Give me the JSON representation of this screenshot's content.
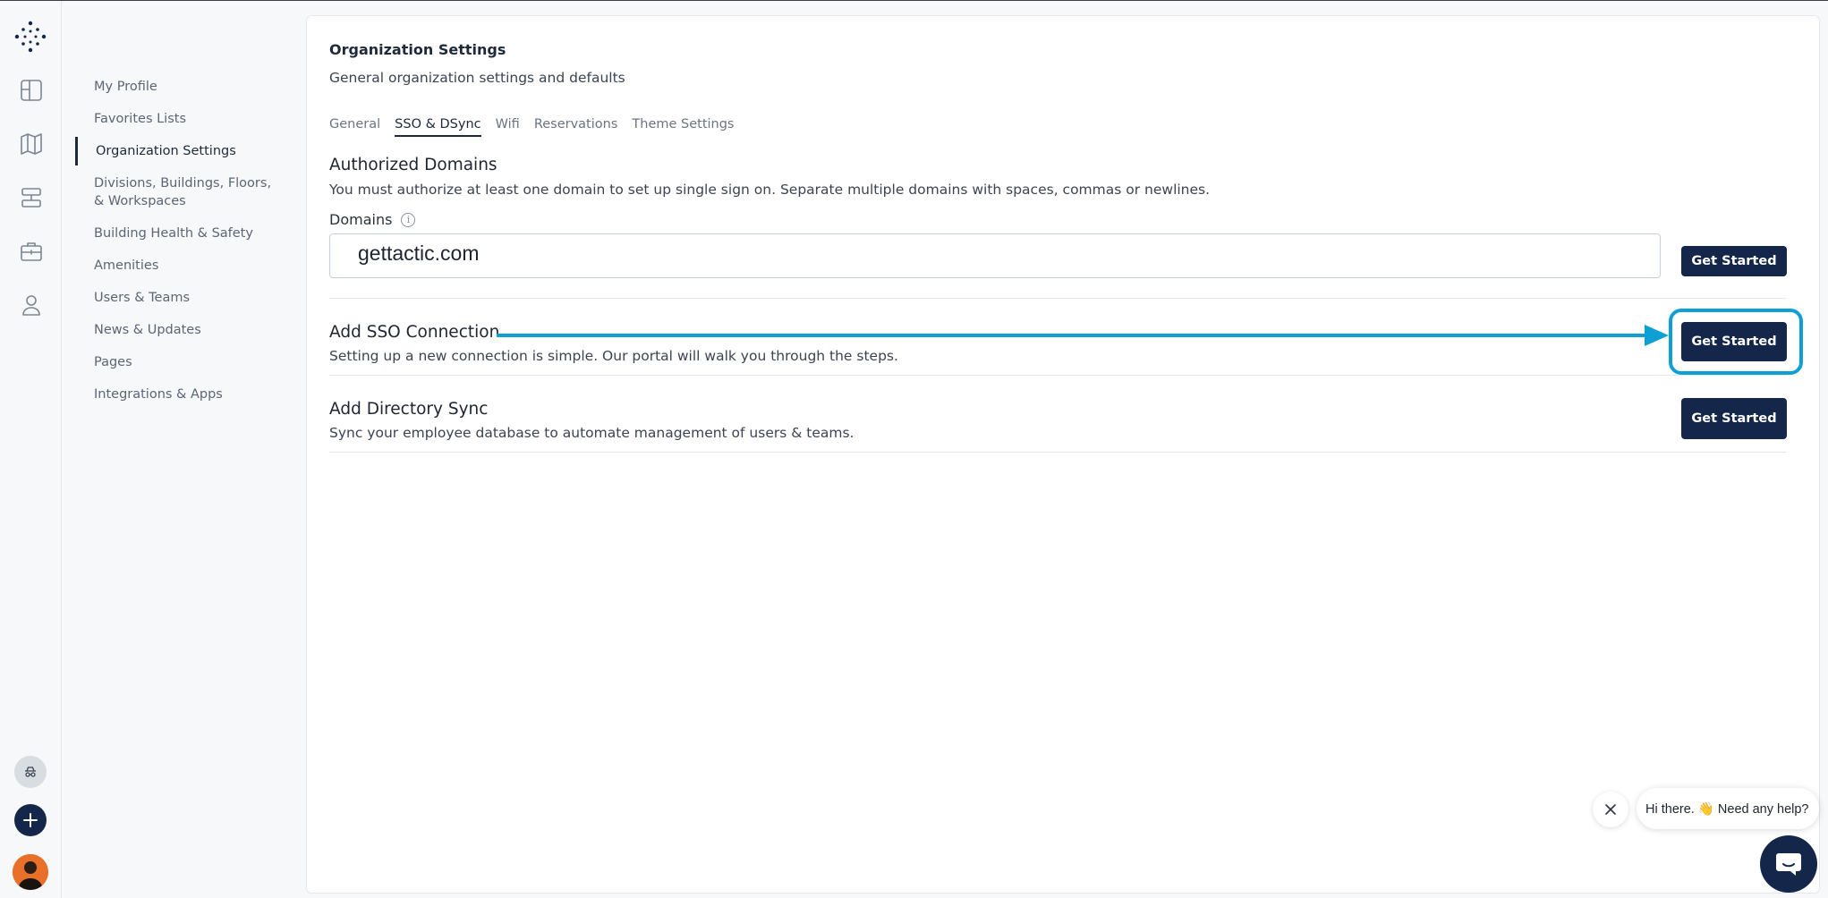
{
  "colors": {
    "primary": "#14274a",
    "highlight": "#0ea0d2",
    "text": "#1e2530",
    "muted": "#5a6676"
  },
  "rail": {
    "icons": [
      "logo-icon",
      "floorplan-icon",
      "map-icon",
      "desks-icon",
      "briefcase-icon",
      "user-icon",
      "ghost-icon",
      "plus-icon",
      "avatar"
    ]
  },
  "subnav": {
    "items": [
      {
        "label": "My Profile"
      },
      {
        "label": "Favorites Lists"
      },
      {
        "label": "Organization Settings",
        "active": true
      },
      {
        "label": "Divisions, Buildings, Floors, & Workspaces"
      },
      {
        "label": "Building Health & Safety"
      },
      {
        "label": "Amenities"
      },
      {
        "label": "Users & Teams"
      },
      {
        "label": "News & Updates"
      },
      {
        "label": "Pages"
      },
      {
        "label": "Integrations & Apps"
      }
    ]
  },
  "main": {
    "title": "Organization Settings",
    "subtitle": "General organization settings and defaults",
    "tabs": [
      {
        "label": "General"
      },
      {
        "label": "SSO & DSync",
        "active": true
      },
      {
        "label": "Wifi"
      },
      {
        "label": "Reservations"
      },
      {
        "label": "Theme Settings"
      }
    ],
    "authorized_domains": {
      "title": "Authorized Domains",
      "description": "You must authorize at least one domain to set up single sign on. Separate multiple domains with spaces, commas or newlines.",
      "field_label": "Domains",
      "field_value": "gettactic.com",
      "button_label": "Get Started"
    },
    "sso": {
      "title": "Add SSO Connection",
      "description": "Setting up a new connection is simple. Our portal will walk you through the steps.",
      "button_label": "Get Started"
    },
    "dsync": {
      "title": "Add Directory Sync",
      "description": "Sync your employee database to automate management of users & teams.",
      "button_label": "Get Started"
    }
  },
  "chat": {
    "greeting": "Hi there. 👋 Need any help?"
  }
}
